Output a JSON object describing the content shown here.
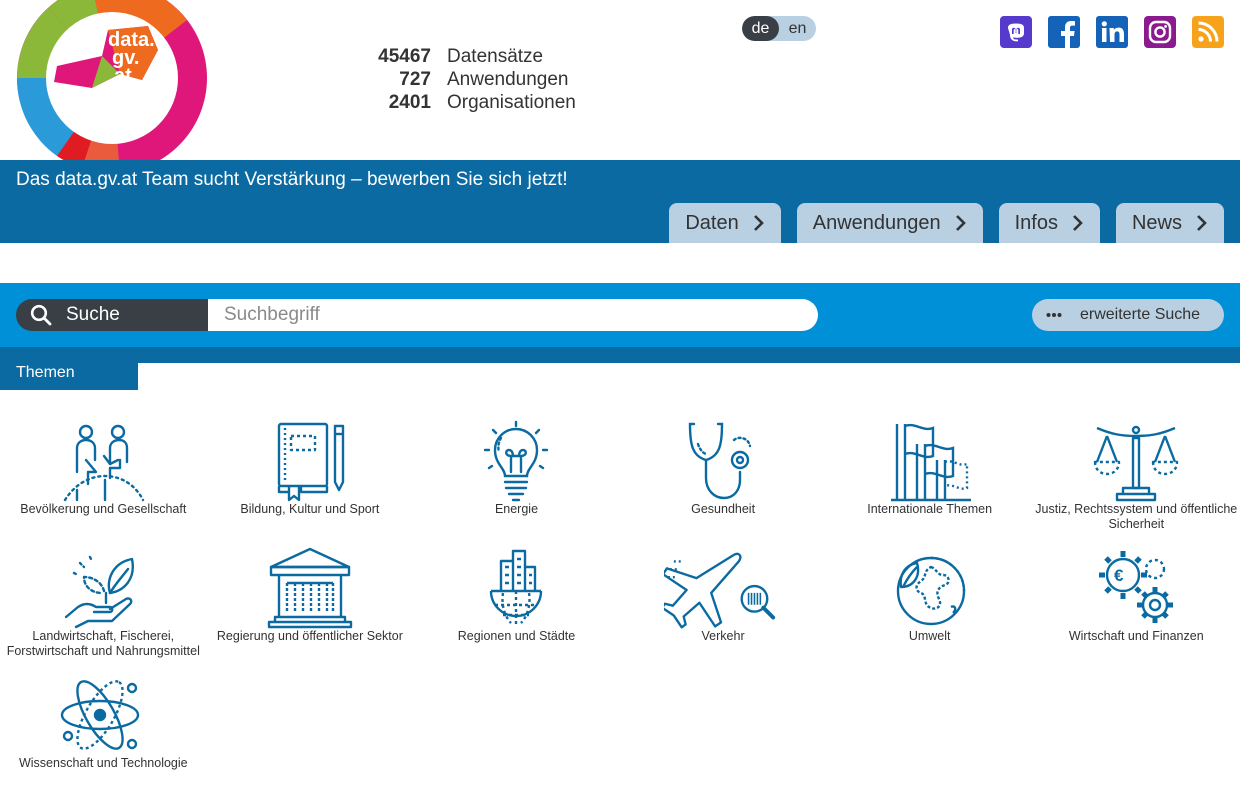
{
  "logo": {
    "line1": "data.",
    "line2": "gv.",
    "line3": "at"
  },
  "stats": [
    {
      "value": "45467",
      "label": "Datensätze"
    },
    {
      "value": "727",
      "label": "Anwendungen"
    },
    {
      "value": "2401",
      "label": "Organisationen"
    }
  ],
  "language": {
    "de": "de",
    "en": "en",
    "active": "de"
  },
  "social": [
    {
      "icon": "mastodon-icon",
      "color": "#563acc"
    },
    {
      "icon": "facebook-icon",
      "color": "#1877f2"
    },
    {
      "icon": "linkedin-icon",
      "color": "#0a66c2"
    },
    {
      "icon": "instagram-icon",
      "color": "#8a1a8e"
    },
    {
      "icon": "rss-icon",
      "color": "#f7a21b"
    }
  ],
  "banner": {
    "text": "Das data.gv.at Team sucht Verstärkung – bewerben Sie sich jetzt!"
  },
  "nav": [
    {
      "label": "Daten"
    },
    {
      "label": "Anwendungen"
    },
    {
      "label": "Infos"
    },
    {
      "label": "News"
    }
  ],
  "search": {
    "label": "Suche",
    "placeholder": "Suchbegriff",
    "advanced": "erweiterte Suche"
  },
  "themen": {
    "label": "Themen"
  },
  "topics": [
    {
      "label": "Bevölkerung und Gesellschaft"
    },
    {
      "label": "Bildung, Kultur und Sport"
    },
    {
      "label": "Energie"
    },
    {
      "label": "Gesundheit"
    },
    {
      "label": "Internationale Themen"
    },
    {
      "label": "Justiz, Rechtssystem und öffentliche Sicherheit"
    },
    {
      "label": "Landwirtschaft, Fischerei, Forstwirtschaft und Nahrungsmittel"
    },
    {
      "label": "Regierung und öffentlicher Sektor"
    },
    {
      "label": "Regionen und Städte"
    },
    {
      "label": "Verkehr"
    },
    {
      "label": "Umwelt"
    },
    {
      "label": "Wirtschaft und Finanzen"
    },
    {
      "label": "Wissenschaft und Technologie"
    }
  ],
  "colors": {
    "primary": "#0a6aa1",
    "search": "#0090d8",
    "tab": "#b9cfe2",
    "dark": "#3a3f46",
    "icon": "#0a6aa1"
  }
}
